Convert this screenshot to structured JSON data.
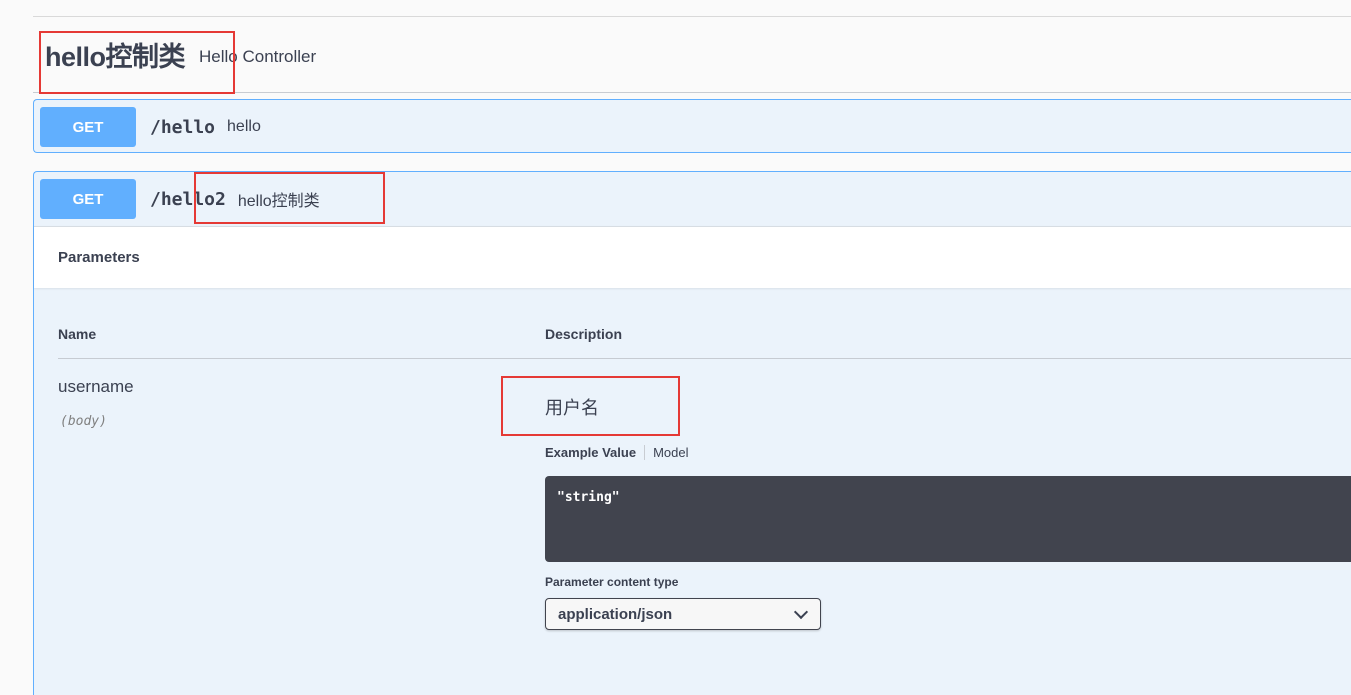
{
  "tag": {
    "title": "hello控制类",
    "description": "Hello Controller"
  },
  "operations": [
    {
      "method": "GET",
      "path": "/hello",
      "summary": "hello"
    },
    {
      "method": "GET",
      "path": "/hello2",
      "summary": "hello控制类",
      "section_title": "Parameters",
      "columns": {
        "name": "Name",
        "description": "Description"
      },
      "parameter": {
        "name": "username",
        "in": "(body)",
        "description": "用户名",
        "example_tabs": {
          "example": "Example Value",
          "model": "Model"
        },
        "example_value": "\"string\"",
        "content_type_label": "Parameter content type",
        "content_type_selected": "application/json"
      }
    }
  ],
  "colors": {
    "get_method": "#61affe",
    "opblock_background": "#ebf3fb",
    "code_background": "#41444e",
    "annotation_red": "#e53935"
  }
}
